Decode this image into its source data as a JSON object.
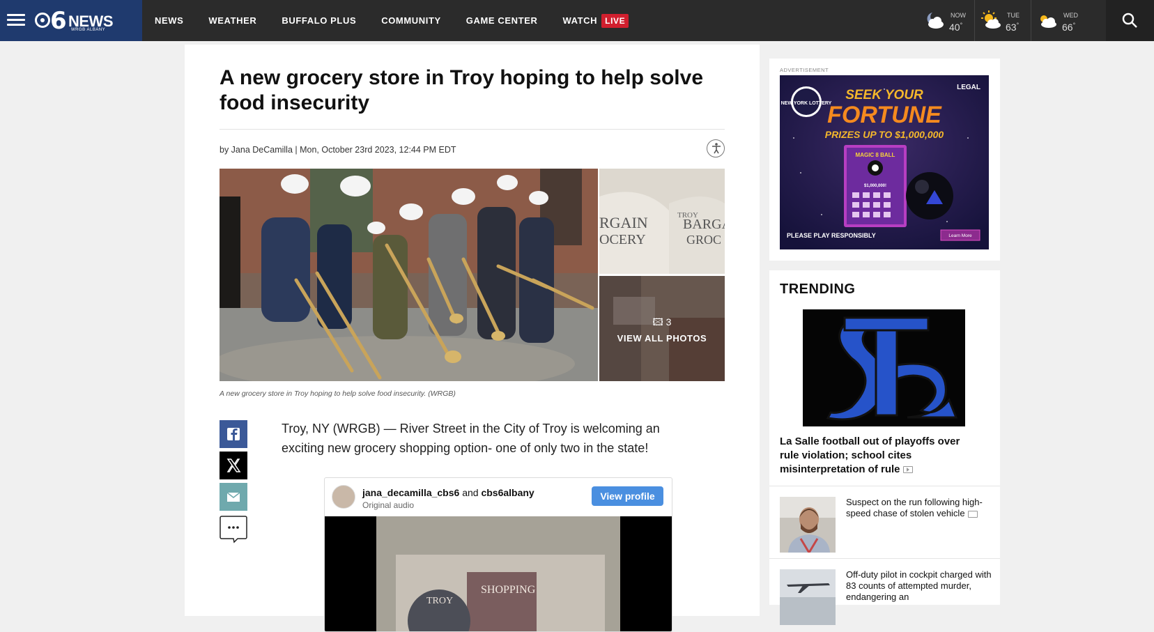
{
  "nav": {
    "logo_main": "NEWS",
    "logo_six": "6",
    "logo_sub": "WRGB ALBANY",
    "items": [
      {
        "label": "NEWS"
      },
      {
        "label": "WEATHER"
      },
      {
        "label": "BUFFALO PLUS"
      },
      {
        "label": "COMMUNITY"
      },
      {
        "label": "GAME CENTER"
      },
      {
        "label": "WATCH"
      }
    ],
    "live_label": "LIVE"
  },
  "weather": [
    {
      "label": "NOW",
      "temp": "40",
      "icon": "night-cloudy-icon"
    },
    {
      "label": "TUE",
      "temp": "63",
      "icon": "partly-sunny-icon"
    },
    {
      "label": "WED",
      "temp": "66",
      "icon": "partly-sunny-icon"
    }
  ],
  "article": {
    "headline": "A new grocery store in Troy hoping to help solve food insecurity",
    "byline": "by Jana DeCamilla | Mon, October 23rd 2023, 12:44 PM EDT",
    "thumb1_text_a": "RGAIN\nOCERY",
    "thumb1_text_b": "TROY\nBARGA\nGROC",
    "photo_count": "3",
    "view_all": "VIEW ALL PHOTOS",
    "caption": "A new grocery store in Troy hoping to help solve food insecurity. (WRGB)",
    "body": "Troy, NY (WRGB) — River Street in the City of Troy is welcoming an exciting new grocery shopping option- one of only two in the state!",
    "embed": {
      "user1": "jana_decamilla_cbs6",
      "and": "and",
      "user2": "cbs6albany",
      "audio": "Original audio",
      "button": "View profile",
      "frame_text_a": "TROY",
      "frame_text_b": "SHOPPING"
    }
  },
  "ad": {
    "label": "ADVERTISEMENT",
    "legal": "LEGAL",
    "seek": "SEEK YOUR",
    "fortune": "FORTUNE",
    "prizes": "PRIZES UP TO $1,000,000",
    "logo": "NEW YORK LOTTERY",
    "ticket_title": "MAGIC 8 BALL",
    "ticket_amount": "$1,000,000!",
    "responsible": "PLEASE PLAY RESPONSIBLY",
    "learn_more": "Learn More"
  },
  "trending": {
    "title": "TRENDING",
    "main_headline": "La Salle football out of playoffs over rule violation; school cites misinterpretation of rule",
    "items": [
      {
        "text": "Suspect on the run following high-speed chase of stolen vehicle"
      },
      {
        "text": "Off-duty pilot in cockpit charged with 83 counts of attempted murder, endangering an"
      }
    ]
  },
  "colors": {
    "nav_bg": "#2b2b2b",
    "logo_bg": "#1f3a6e",
    "live": "#d11f2e",
    "facebook": "#3b5998",
    "mail": "#6fa9ad",
    "ig_button": "#4a8fe0"
  }
}
